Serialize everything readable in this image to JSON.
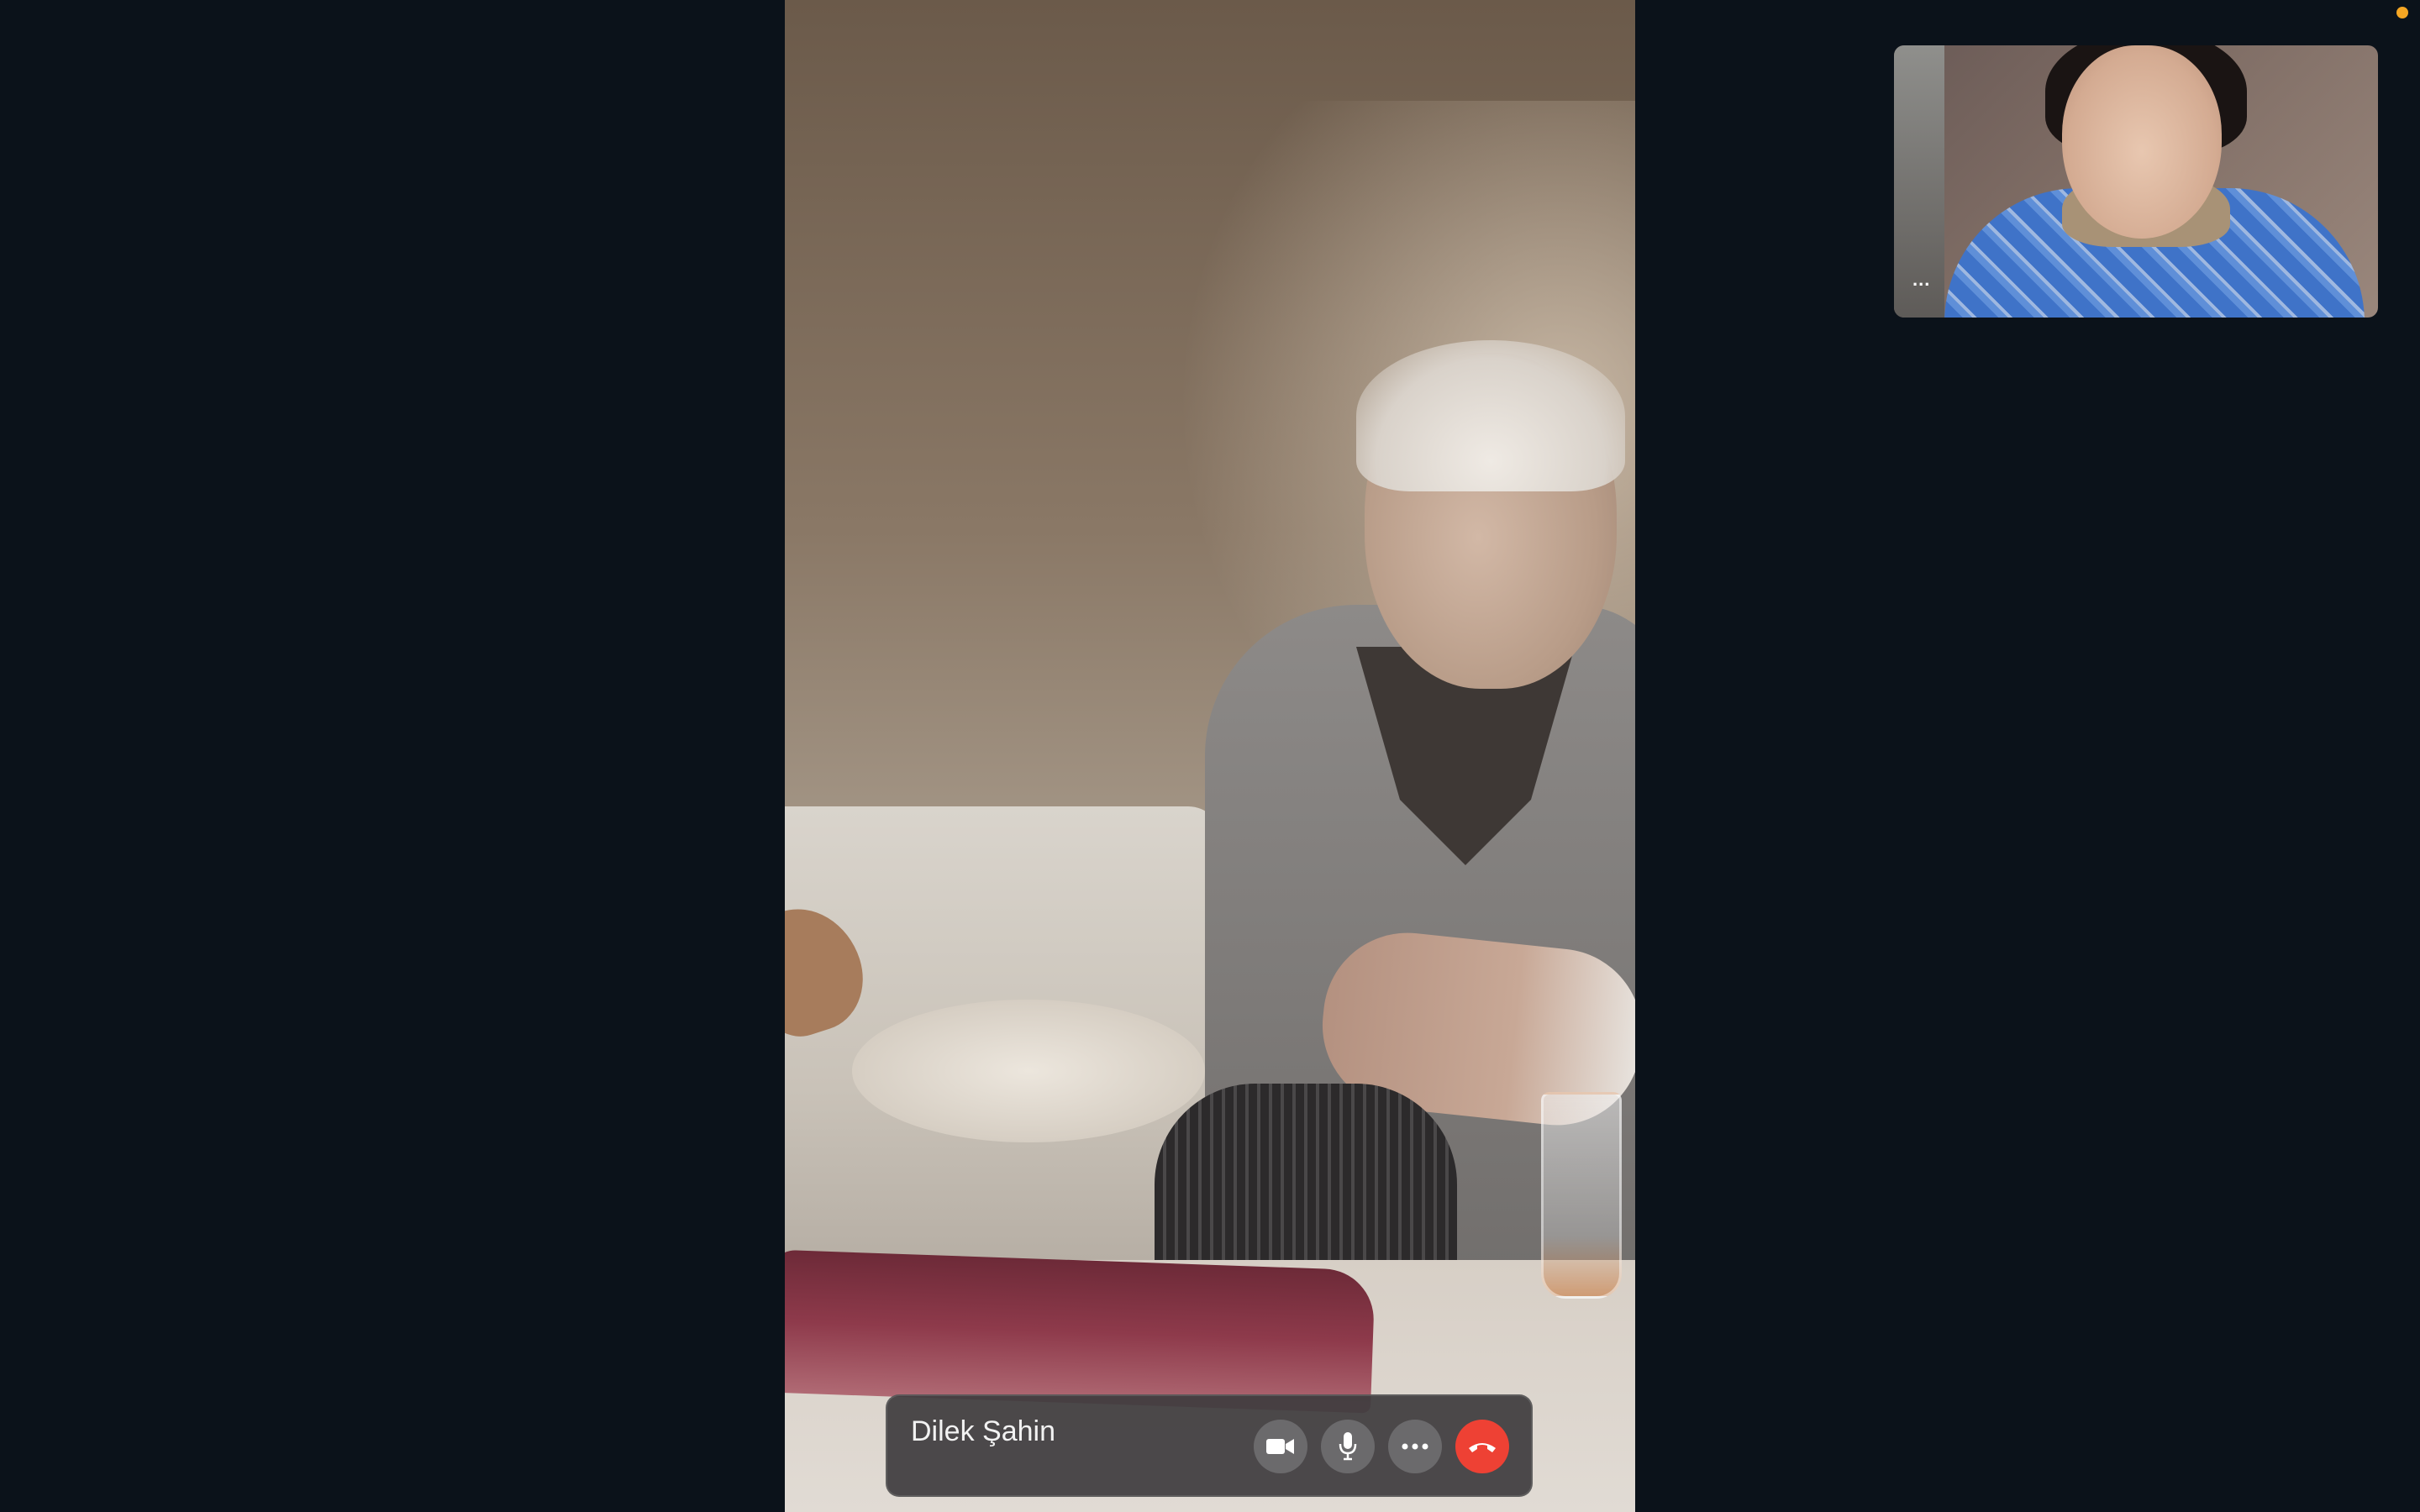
{
  "call": {
    "caller_name": "Dilek Şahin"
  },
  "controls": {
    "camera_icon": "video-camera-icon",
    "mic_icon": "microphone-icon",
    "more_icon": "ellipsis-icon",
    "end_icon": "end-call-icon"
  },
  "self_view": {
    "more_label": "..."
  },
  "colors": {
    "background": "#0b121a",
    "control_bar": "#3e3c3e",
    "control_button": "#6b6a6c",
    "end_call": "#ee4134",
    "status_dot": "#f5a623"
  }
}
